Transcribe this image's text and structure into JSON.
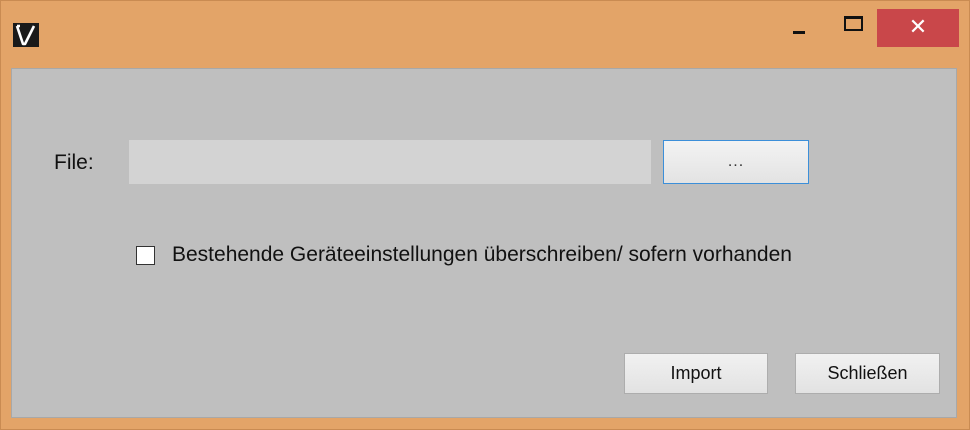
{
  "window": {
    "app_icon": "app-logo-icon",
    "controls": {
      "minimize_icon": "minimize-icon",
      "maximize_icon": "maximize-icon",
      "close_glyph": "✕"
    },
    "colors": {
      "titlebar": "#e3a468",
      "close_button": "#c9474a",
      "client_background": "#bfbfbf"
    }
  },
  "form": {
    "file_label": "File:",
    "file_value": "",
    "browse_label": "...",
    "overwrite_checked": false,
    "overwrite_label": "Bestehende Geräteeinstellungen überschreiben/ sofern vorhanden"
  },
  "actions": {
    "import_label": "Import",
    "close_label": "Schließen"
  }
}
